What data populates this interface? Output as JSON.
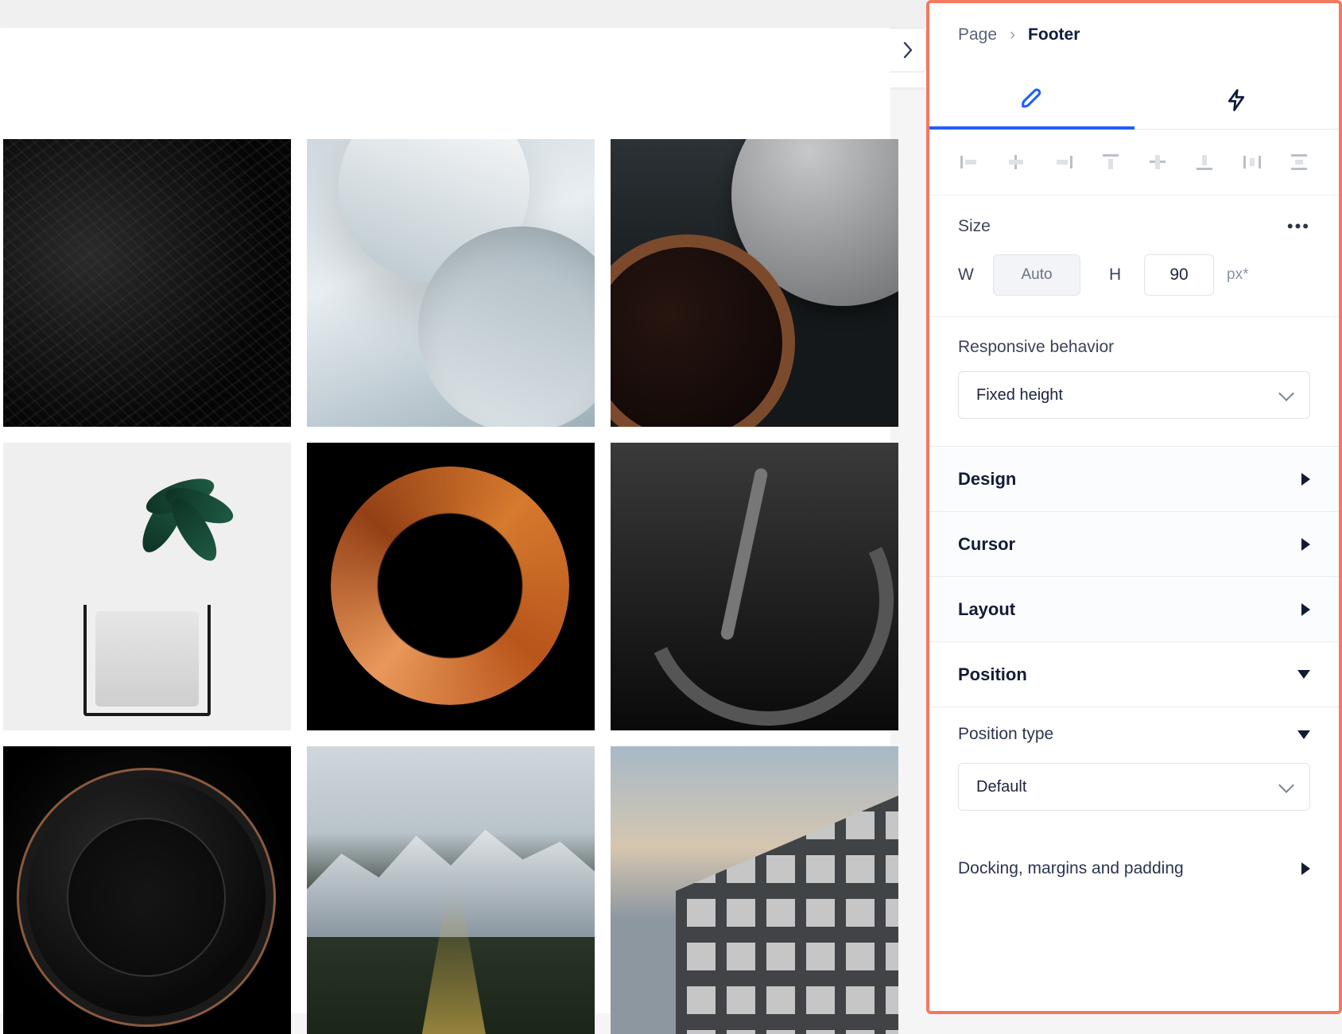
{
  "breadcrumb": {
    "root": "Page",
    "current": "Footer"
  },
  "panel": {
    "size": {
      "title": "Size",
      "width_label": "W",
      "width_value": "Auto",
      "height_label": "H",
      "height_value": "90",
      "height_unit": "px*"
    },
    "responsive": {
      "label": "Responsive behavior",
      "value": "Fixed height"
    },
    "accordion": {
      "design": "Design",
      "cursor": "Cursor",
      "layout": "Layout",
      "position": "Position",
      "position_type_label": "Position type",
      "position_type_value": "Default",
      "docking": "Docking, margins and padding"
    }
  }
}
